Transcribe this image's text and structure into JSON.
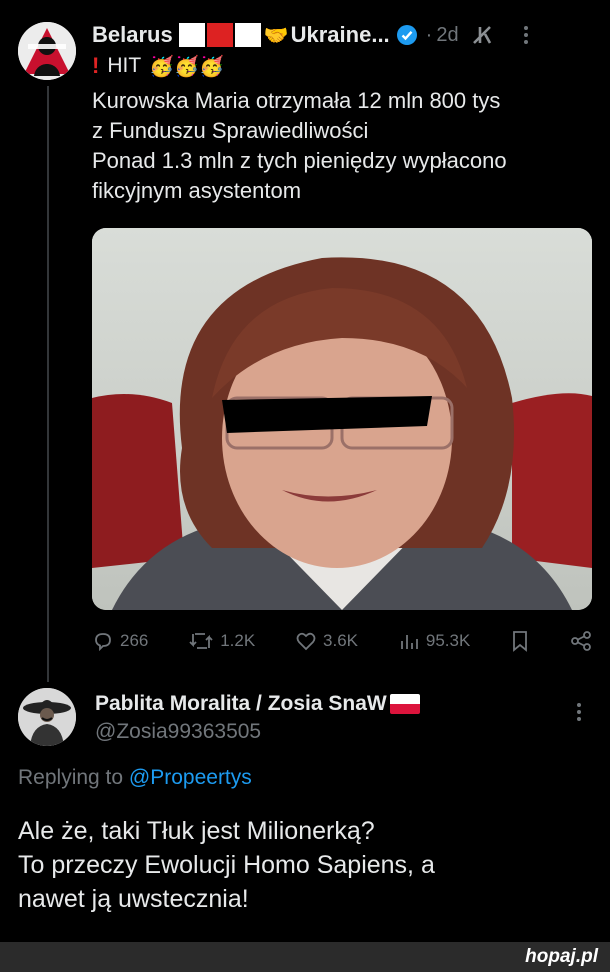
{
  "tweet": {
    "author_name_left": "Belarus",
    "author_name_right": "Ukraine...",
    "time": "2d",
    "hit_label": "HIT",
    "text_lines": [
      "Kurowska Maria otrzymała 12 mln 800 tys",
      "z Funduszu Sprawiedliwości",
      "Ponad 1.3 mln z tych pieniędzy wypłacono",
      "fikcyjnym asystentom"
    ],
    "stats": {
      "replies": "266",
      "reposts": "1.2K",
      "likes": "3.6K",
      "views": "95.3K"
    }
  },
  "reply": {
    "author_name": "Pablita Moralita / Zosia SnaW",
    "handle": "@Zosia99363505",
    "replying_prefix": "Replying to",
    "replying_to": "@Propeertys",
    "text_lines": [
      "Ale że, taki Tłuk jest Milionerką?",
      "To przeczy Ewolucji Homo Sapiens, a",
      "nawet ją uwstecznia!"
    ]
  },
  "watermark": "hopaj.pl",
  "colors": {
    "background": "#000000",
    "text": "#e7e9ea",
    "muted": "#71767b",
    "link": "#1d9bf0",
    "verified": "#1d9bf0"
  }
}
